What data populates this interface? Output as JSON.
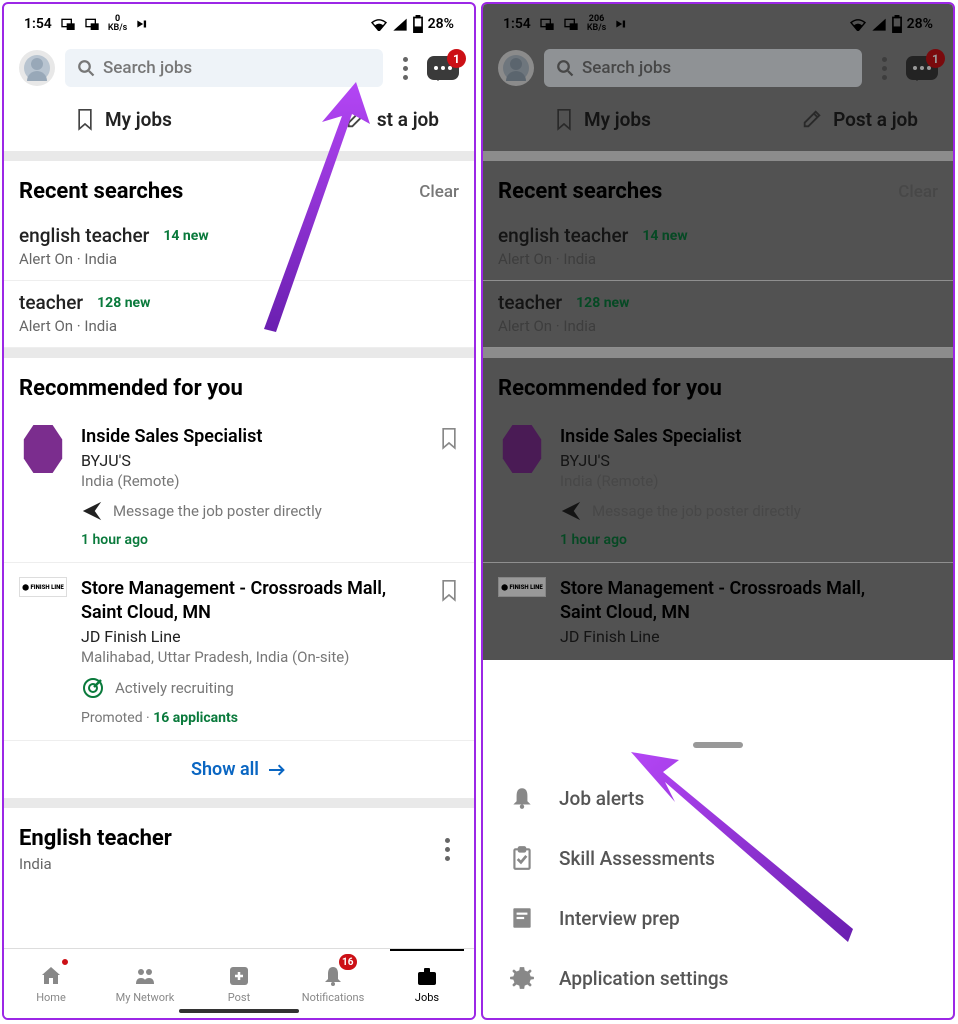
{
  "left": {
    "status": {
      "time": "1:54",
      "kbs_num": "0",
      "kbs_unit": "KB/s",
      "battery": "28%"
    },
    "search_placeholder": "Search jobs",
    "msg_badge": "1",
    "tabs": {
      "myjobs": "My jobs",
      "postjob": "Post a job"
    },
    "recent": {
      "title": "Recent searches",
      "clear": "Clear",
      "items": [
        {
          "title": "english teacher",
          "new": "14 new",
          "sub": "Alert On · India"
        },
        {
          "title": "teacher",
          "new": "128 new",
          "sub": "Alert On · India"
        }
      ]
    },
    "recommended": {
      "title": "Recommended for you",
      "jobs": [
        {
          "title": "Inside Sales Specialist",
          "company": "BYJU'S",
          "location": "India (Remote)",
          "meta": "Message the job poster directly",
          "time": "1 hour ago"
        },
        {
          "title": "Store Management - Crossroads Mall, Saint Cloud, MN",
          "company": "JD Finish Line",
          "location": "Malihabad, Uttar Pradesh, India (On-site)",
          "recruit": "Actively recruiting",
          "promoted": "Promoted · ",
          "applicants": "16 applicants"
        }
      ],
      "show_all": "Show all"
    },
    "english_teacher": {
      "title": "English teacher",
      "sub": "India"
    },
    "nav": {
      "home": "Home",
      "network": "My Network",
      "post": "Post",
      "notif": "Notifications",
      "jobs": "Jobs",
      "notif_badge": "16"
    }
  },
  "right": {
    "status": {
      "time": "1:54",
      "kbs_num": "206",
      "kbs_unit": "KB/s",
      "battery": "28%"
    },
    "search_placeholder": "Search jobs",
    "msg_badge": "1",
    "tabs": {
      "myjobs": "My jobs",
      "postjob": "Post a job"
    },
    "recent": {
      "title": "Recent searches",
      "clear": "Clear",
      "items": [
        {
          "title": "english teacher",
          "new": "14 new",
          "sub": "Alert On · India"
        },
        {
          "title": "teacher",
          "new": "128 new",
          "sub": "Alert On · India"
        }
      ]
    },
    "recommended": {
      "title": "Recommended for you",
      "jobs": [
        {
          "title": "Inside Sales Specialist",
          "company": "BYJU'S",
          "location": "India (Remote)",
          "meta": "Message the job poster directly",
          "time": "1 hour ago"
        },
        {
          "title": "Store Management - Crossroads Mall, Saint Cloud, MN",
          "company": "JD Finish Line"
        }
      ]
    },
    "sheet": {
      "items": [
        {
          "label": "Job alerts"
        },
        {
          "label": "Skill Assessments"
        },
        {
          "label": "Interview prep"
        },
        {
          "label": "Application settings"
        }
      ]
    }
  }
}
